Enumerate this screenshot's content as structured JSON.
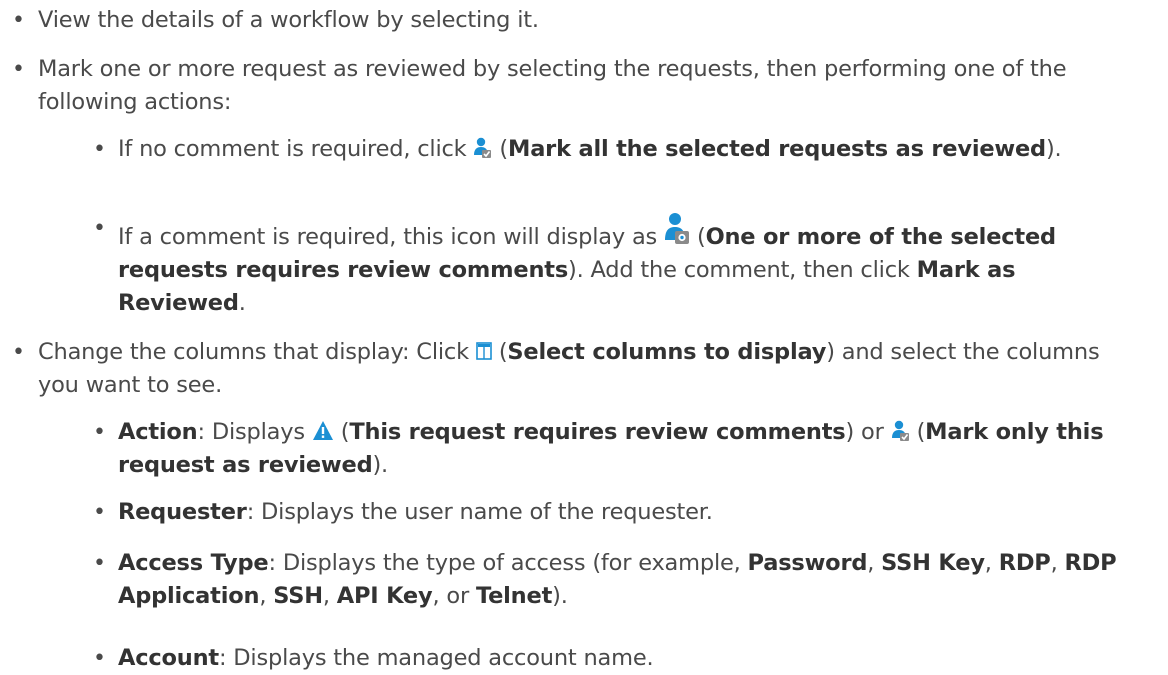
{
  "colors": {
    "text": "#4a4a4a",
    "bold": "#333333",
    "icon_blue": "#1b8fd3",
    "icon_grey": "#8a8a8a"
  },
  "bullet": "•",
  "items": [
    {
      "text": "View the details of a workflow by selecting it."
    },
    {
      "text": "Mark one or more request as reviewed by selecting the requests, then performing one of the following actions:"
    },
    {
      "pre": "If no comment is required, click ",
      "icon": "mark-reviewed-user-icon",
      "open": " (",
      "bold": "Mark all the selected requests as reviewed",
      "close": ")."
    },
    {
      "pre": "If a comment is required, this icon will display as ",
      "icon": "review-comments-required-icon",
      "open": " (",
      "bold": "One or more of the selected requests requires review comments",
      "mid": "). Add the comment, then click ",
      "bold2": "Mark as Reviewed",
      "end": "."
    },
    {
      "pre": "Change the columns that display: Click ",
      "icon": "columns-icon",
      "open": " (",
      "bold": "Select columns to display",
      "post": ") and select the columns you want to see."
    },
    {
      "b1": "Action",
      "t1": ": Displays ",
      "icon1": "warning-icon",
      "t2": " (",
      "b2": "This request requires review comments",
      "t3": ") or ",
      "icon2": "mark-reviewed-user-icon",
      "t4": " (",
      "b3": "Mark only this request as reviewed",
      "t5": ")."
    },
    {
      "b1": "Requester",
      "t1": ": Displays the user name of the requester."
    },
    {
      "b1": "Access Type",
      "t1": ": Displays the type of access (for example, ",
      "b2": "Password",
      "s1": ", ",
      "b3": "SSH Key",
      "s2": ", ",
      "b4": "RDP",
      "s3": ", ",
      "b5": "RDP Application",
      "s4": ", ",
      "b6": "SSH",
      "s5": ", ",
      "b7": "API Key",
      "s6": ", or ",
      "b8": "Telnet",
      "s7": ")."
    },
    {
      "b1": "Account",
      "t1": ": Displays the managed account name."
    }
  ]
}
